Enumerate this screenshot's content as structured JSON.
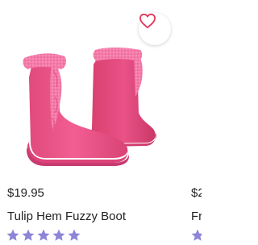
{
  "product": {
    "price": "$19.95",
    "title": "Tulip Hem Fuzzy Boot",
    "rating": 5,
    "rating_max": 5,
    "image_alt": "Pink fuzzy suede boots",
    "favorite_icon": "heart-outline-icon",
    "star_icon": "star-icon"
  },
  "next_product": {
    "price": "$2",
    "title": "Fr"
  },
  "colors": {
    "boot": "#ee4f8c",
    "boot_dark": "#c83a70",
    "fur": "#f37aa6",
    "sole": "#e5487f",
    "heart": "#e0385e",
    "star": "#8e85d8"
  }
}
